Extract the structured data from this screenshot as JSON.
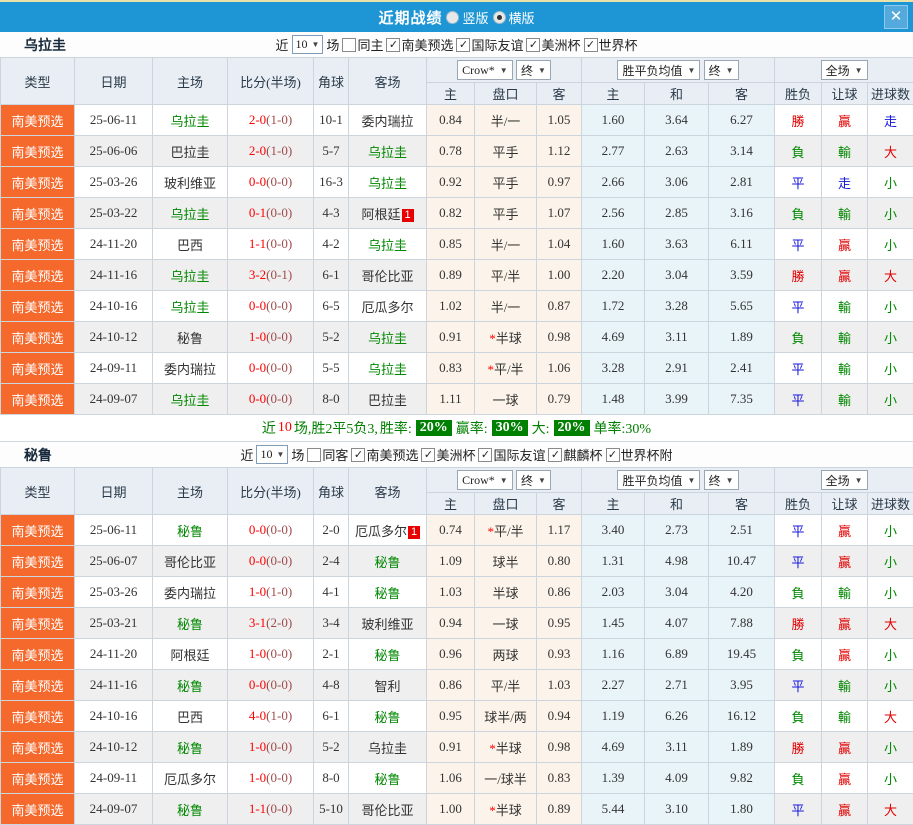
{
  "header": {
    "title": "近期战绩",
    "layout_options": [
      {
        "label": "竖版",
        "selected": false
      },
      {
        "label": "横版",
        "selected": true
      }
    ],
    "close_label": "X"
  },
  "colors": {
    "titlebar": "#1e95d4",
    "type_cell": "#f5692c",
    "win_red": "#e10000",
    "lose_green": "#008800",
    "draw_blue": "#1414dd",
    "focus_team_green": "#008800",
    "badge_green": "#008000"
  },
  "table_header": {
    "main_cols": [
      "类型",
      "日期",
      "主场",
      "比分(半场)",
      "角球",
      "客场"
    ],
    "group1": {
      "select_a": "Crow*",
      "select_b": "终",
      "subs": [
        "主",
        "盘口",
        "客"
      ]
    },
    "group2": {
      "select_a": "胜平负均值",
      "select_b": "终",
      "subs": [
        "主",
        "和",
        "客"
      ]
    },
    "group3": {
      "select_a": "全场",
      "subs": [
        "胜负",
        "让球",
        "进球数"
      ]
    }
  },
  "sections": [
    {
      "team": "乌拉圭",
      "filters": {
        "near_label": "近",
        "count": "10",
        "games_label": "场",
        "same": {
          "label": "同主",
          "checked": false
        },
        "competitions": [
          {
            "label": "南美预选",
            "checked": true
          },
          {
            "label": "国际友谊",
            "checked": true
          },
          {
            "label": "美洲杯",
            "checked": true
          },
          {
            "label": "世界杯",
            "checked": true
          }
        ]
      },
      "rows": [
        {
          "type": "南美预选",
          "date": "25-06-11",
          "home": {
            "name": "乌拉圭",
            "focus": true
          },
          "ft": "2-0",
          "ht": "(1-0)",
          "corner": "10-1",
          "away": {
            "name": "委内瑞拉",
            "focus": false
          },
          "odds": [
            "0.84",
            "半/一",
            "1.05"
          ],
          "avg": [
            "1.60",
            "3.64",
            "6.27"
          ],
          "results": [
            {
              "t": "勝",
              "c": "red"
            },
            {
              "t": "贏",
              "c": "red"
            },
            {
              "t": "走",
              "c": "blue"
            }
          ]
        },
        {
          "type": "南美预选",
          "date": "25-06-06",
          "home": {
            "name": "巴拉圭",
            "focus": false
          },
          "ft": "2-0",
          "ht": "(1-0)",
          "corner": "5-7",
          "away": {
            "name": "乌拉圭",
            "focus": true
          },
          "odds": [
            "0.78",
            "平手",
            "1.12"
          ],
          "avg": [
            "2.77",
            "2.63",
            "3.14"
          ],
          "results": [
            {
              "t": "負",
              "c": "green"
            },
            {
              "t": "輸",
              "c": "green"
            },
            {
              "t": "大",
              "c": "red"
            }
          ]
        },
        {
          "type": "南美预选",
          "date": "25-03-26",
          "home": {
            "name": "玻利维亚",
            "focus": false
          },
          "ft": "0-0",
          "ht": "(0-0)",
          "corner": "16-3",
          "away": {
            "name": "乌拉圭",
            "focus": true
          },
          "odds": [
            "0.92",
            "平手",
            "0.97"
          ],
          "avg": [
            "2.66",
            "3.06",
            "2.81"
          ],
          "results": [
            {
              "t": "平",
              "c": "blue"
            },
            {
              "t": "走",
              "c": "blue"
            },
            {
              "t": "小",
              "c": "green"
            }
          ]
        },
        {
          "type": "南美预选",
          "date": "25-03-22",
          "home": {
            "name": "乌拉圭",
            "focus": true
          },
          "ft": "0-1",
          "ht": "(0-0)",
          "corner": "4-3",
          "away": {
            "name": "阿根廷",
            "focus": false,
            "red_cards": "1"
          },
          "odds": [
            "0.82",
            "平手",
            "1.07"
          ],
          "avg": [
            "2.56",
            "2.85",
            "3.16"
          ],
          "results": [
            {
              "t": "負",
              "c": "green"
            },
            {
              "t": "輸",
              "c": "green"
            },
            {
              "t": "小",
              "c": "green"
            }
          ]
        },
        {
          "type": "南美预选",
          "date": "24-11-20",
          "home": {
            "name": "巴西",
            "focus": false
          },
          "ft": "1-1",
          "ht": "(0-0)",
          "corner": "4-2",
          "away": {
            "name": "乌拉圭",
            "focus": true
          },
          "odds": [
            "0.85",
            "半/一",
            "1.04"
          ],
          "avg": [
            "1.60",
            "3.63",
            "6.11"
          ],
          "results": [
            {
              "t": "平",
              "c": "blue"
            },
            {
              "t": "贏",
              "c": "red"
            },
            {
              "t": "小",
              "c": "green"
            }
          ]
        },
        {
          "type": "南美预选",
          "date": "24-11-16",
          "home": {
            "name": "乌拉圭",
            "focus": true
          },
          "ft": "3-2",
          "ht": "(0-1)",
          "corner": "6-1",
          "away": {
            "name": "哥伦比亚",
            "focus": false
          },
          "odds": [
            "0.89",
            "平/半",
            "1.00"
          ],
          "avg": [
            "2.20",
            "3.04",
            "3.59"
          ],
          "results": [
            {
              "t": "勝",
              "c": "red"
            },
            {
              "t": "贏",
              "c": "red"
            },
            {
              "t": "大",
              "c": "red"
            }
          ]
        },
        {
          "type": "南美预选",
          "date": "24-10-16",
          "home": {
            "name": "乌拉圭",
            "focus": true
          },
          "ft": "0-0",
          "ht": "(0-0)",
          "corner": "6-5",
          "away": {
            "name": "厄瓜多尔",
            "focus": false
          },
          "odds": [
            "1.02",
            "半/一",
            "0.87"
          ],
          "avg": [
            "1.72",
            "3.28",
            "5.65"
          ],
          "results": [
            {
              "t": "平",
              "c": "blue"
            },
            {
              "t": "輸",
              "c": "green"
            },
            {
              "t": "小",
              "c": "green"
            }
          ]
        },
        {
          "type": "南美预选",
          "date": "24-10-12",
          "home": {
            "name": "秘鲁",
            "focus": false
          },
          "ft": "1-0",
          "ht": "(0-0)",
          "corner": "5-2",
          "away": {
            "name": "乌拉圭",
            "focus": true
          },
          "odds": [
            "0.91",
            "*半球",
            "0.98"
          ],
          "avg": [
            "4.69",
            "3.11",
            "1.89"
          ],
          "results": [
            {
              "t": "負",
              "c": "green"
            },
            {
              "t": "輸",
              "c": "green"
            },
            {
              "t": "小",
              "c": "green"
            }
          ]
        },
        {
          "type": "南美预选",
          "date": "24-09-11",
          "home": {
            "name": "委内瑞拉",
            "focus": false
          },
          "ft": "0-0",
          "ht": "(0-0)",
          "corner": "5-5",
          "away": {
            "name": "乌拉圭",
            "focus": true
          },
          "odds": [
            "0.83",
            "*平/半",
            "1.06"
          ],
          "avg": [
            "3.28",
            "2.91",
            "2.41"
          ],
          "results": [
            {
              "t": "平",
              "c": "blue"
            },
            {
              "t": "輸",
              "c": "green"
            },
            {
              "t": "小",
              "c": "green"
            }
          ]
        },
        {
          "type": "南美预选",
          "date": "24-09-07",
          "home": {
            "name": "乌拉圭",
            "focus": true
          },
          "ft": "0-0",
          "ht": "(0-0)",
          "corner": "8-0",
          "away": {
            "name": "巴拉圭",
            "focus": false
          },
          "odds": [
            "1.11",
            "一球",
            "0.79"
          ],
          "avg": [
            "1.48",
            "3.99",
            "7.35"
          ],
          "results": [
            {
              "t": "平",
              "c": "blue"
            },
            {
              "t": "輸",
              "c": "green"
            },
            {
              "t": "小",
              "c": "green"
            }
          ]
        }
      ],
      "summary": {
        "parts": [
          {
            "text": "近",
            "style": "green"
          },
          {
            "text": "10",
            "style": "red"
          },
          {
            "text": "场,胜2平5负3, ",
            "style": "green"
          },
          {
            "text": "胜率: ",
            "style": "green"
          },
          {
            "text": "20%",
            "style": "badge"
          },
          {
            "text": " 赢率: ",
            "style": "green"
          },
          {
            "text": "30%",
            "style": "badge"
          },
          {
            "text": " 大: ",
            "style": "green"
          },
          {
            "text": "20%",
            "style": "badge"
          },
          {
            "text": " 单率:30%",
            "style": "green"
          }
        ]
      }
    },
    {
      "team": "秘鲁",
      "filters": {
        "near_label": "近",
        "count": "10",
        "games_label": "场",
        "same": {
          "label": "同客",
          "checked": false
        },
        "competitions": [
          {
            "label": "南美预选",
            "checked": true
          },
          {
            "label": "美洲杯",
            "checked": true
          },
          {
            "label": "国际友谊",
            "checked": true
          },
          {
            "label": "麒麟杯",
            "checked": true
          },
          {
            "label": "世界杯附",
            "checked": true
          }
        ]
      },
      "rows": [
        {
          "type": "南美预选",
          "date": "25-06-11",
          "home": {
            "name": "秘鲁",
            "focus": true
          },
          "ft": "0-0",
          "ht": "(0-0)",
          "corner": "2-0",
          "away": {
            "name": "厄瓜多尔",
            "focus": false,
            "red_cards": "1"
          },
          "odds": [
            "0.74",
            "*平/半",
            "1.17"
          ],
          "avg": [
            "3.40",
            "2.73",
            "2.51"
          ],
          "results": [
            {
              "t": "平",
              "c": "blue"
            },
            {
              "t": "贏",
              "c": "red"
            },
            {
              "t": "小",
              "c": "green"
            }
          ]
        },
        {
          "type": "南美预选",
          "date": "25-06-07",
          "home": {
            "name": "哥伦比亚",
            "focus": false
          },
          "ft": "0-0",
          "ht": "(0-0)",
          "corner": "2-4",
          "away": {
            "name": "秘鲁",
            "focus": true
          },
          "odds": [
            "1.09",
            "球半",
            "0.80"
          ],
          "avg": [
            "1.31",
            "4.98",
            "10.47"
          ],
          "results": [
            {
              "t": "平",
              "c": "blue"
            },
            {
              "t": "贏",
              "c": "red"
            },
            {
              "t": "小",
              "c": "green"
            }
          ]
        },
        {
          "type": "南美预选",
          "date": "25-03-26",
          "home": {
            "name": "委内瑞拉",
            "focus": false
          },
          "ft": "1-0",
          "ht": "(1-0)",
          "corner": "4-1",
          "away": {
            "name": "秘鲁",
            "focus": true
          },
          "odds": [
            "1.03",
            "半球",
            "0.86"
          ],
          "avg": [
            "2.03",
            "3.04",
            "4.20"
          ],
          "results": [
            {
              "t": "負",
              "c": "green"
            },
            {
              "t": "輸",
              "c": "green"
            },
            {
              "t": "小",
              "c": "green"
            }
          ]
        },
        {
          "type": "南美预选",
          "date": "25-03-21",
          "home": {
            "name": "秘鲁",
            "focus": true
          },
          "ft": "3-1",
          "ht": "(2-0)",
          "corner": "3-4",
          "away": {
            "name": "玻利维亚",
            "focus": false
          },
          "odds": [
            "0.94",
            "一球",
            "0.95"
          ],
          "avg": [
            "1.45",
            "4.07",
            "7.88"
          ],
          "results": [
            {
              "t": "勝",
              "c": "red"
            },
            {
              "t": "贏",
              "c": "red"
            },
            {
              "t": "大",
              "c": "red"
            }
          ]
        },
        {
          "type": "南美预选",
          "date": "24-11-20",
          "home": {
            "name": "阿根廷",
            "focus": false
          },
          "ft": "1-0",
          "ht": "(0-0)",
          "corner": "2-1",
          "away": {
            "name": "秘鲁",
            "focus": true
          },
          "odds": [
            "0.96",
            "两球",
            "0.93"
          ],
          "avg": [
            "1.16",
            "6.89",
            "19.45"
          ],
          "results": [
            {
              "t": "負",
              "c": "green"
            },
            {
              "t": "贏",
              "c": "red"
            },
            {
              "t": "小",
              "c": "green"
            }
          ]
        },
        {
          "type": "南美预选",
          "date": "24-11-16",
          "home": {
            "name": "秘鲁",
            "focus": true
          },
          "ft": "0-0",
          "ht": "(0-0)",
          "corner": "4-8",
          "away": {
            "name": "智利",
            "focus": false
          },
          "odds": [
            "0.86",
            "平/半",
            "1.03"
          ],
          "avg": [
            "2.27",
            "2.71",
            "3.95"
          ],
          "results": [
            {
              "t": "平",
              "c": "blue"
            },
            {
              "t": "輸",
              "c": "green"
            },
            {
              "t": "小",
              "c": "green"
            }
          ]
        },
        {
          "type": "南美预选",
          "date": "24-10-16",
          "home": {
            "name": "巴西",
            "focus": false
          },
          "ft": "4-0",
          "ht": "(1-0)",
          "corner": "6-1",
          "away": {
            "name": "秘鲁",
            "focus": true
          },
          "odds": [
            "0.95",
            "球半/两",
            "0.94"
          ],
          "avg": [
            "1.19",
            "6.26",
            "16.12"
          ],
          "results": [
            {
              "t": "負",
              "c": "green"
            },
            {
              "t": "輸",
              "c": "green"
            },
            {
              "t": "大",
              "c": "red"
            }
          ]
        },
        {
          "type": "南美预选",
          "date": "24-10-12",
          "home": {
            "name": "秘鲁",
            "focus": true
          },
          "ft": "1-0",
          "ht": "(0-0)",
          "corner": "5-2",
          "away": {
            "name": "乌拉圭",
            "focus": false
          },
          "odds": [
            "0.91",
            "*半球",
            "0.98"
          ],
          "avg": [
            "4.69",
            "3.11",
            "1.89"
          ],
          "results": [
            {
              "t": "勝",
              "c": "red"
            },
            {
              "t": "贏",
              "c": "red"
            },
            {
              "t": "小",
              "c": "green"
            }
          ]
        },
        {
          "type": "南美预选",
          "date": "24-09-11",
          "home": {
            "name": "厄瓜多尔",
            "focus": false
          },
          "ft": "1-0",
          "ht": "(0-0)",
          "corner": "8-0",
          "away": {
            "name": "秘鲁",
            "focus": true
          },
          "odds": [
            "1.06",
            "一/球半",
            "0.83"
          ],
          "avg": [
            "1.39",
            "4.09",
            "9.82"
          ],
          "results": [
            {
              "t": "負",
              "c": "green"
            },
            {
              "t": "贏",
              "c": "red"
            },
            {
              "t": "小",
              "c": "green"
            }
          ]
        },
        {
          "type": "南美预选",
          "date": "24-09-07",
          "home": {
            "name": "秘鲁",
            "focus": true
          },
          "ft": "1-1",
          "ht": "(0-0)",
          "corner": "5-10",
          "away": {
            "name": "哥伦比亚",
            "focus": false
          },
          "odds": [
            "1.00",
            "*半球",
            "0.89"
          ],
          "avg": [
            "5.44",
            "3.10",
            "1.80"
          ],
          "results": [
            {
              "t": "平",
              "c": "blue"
            },
            {
              "t": "贏",
              "c": "red"
            },
            {
              "t": "大",
              "c": "red"
            }
          ]
        }
      ],
      "summary": null
    }
  ]
}
